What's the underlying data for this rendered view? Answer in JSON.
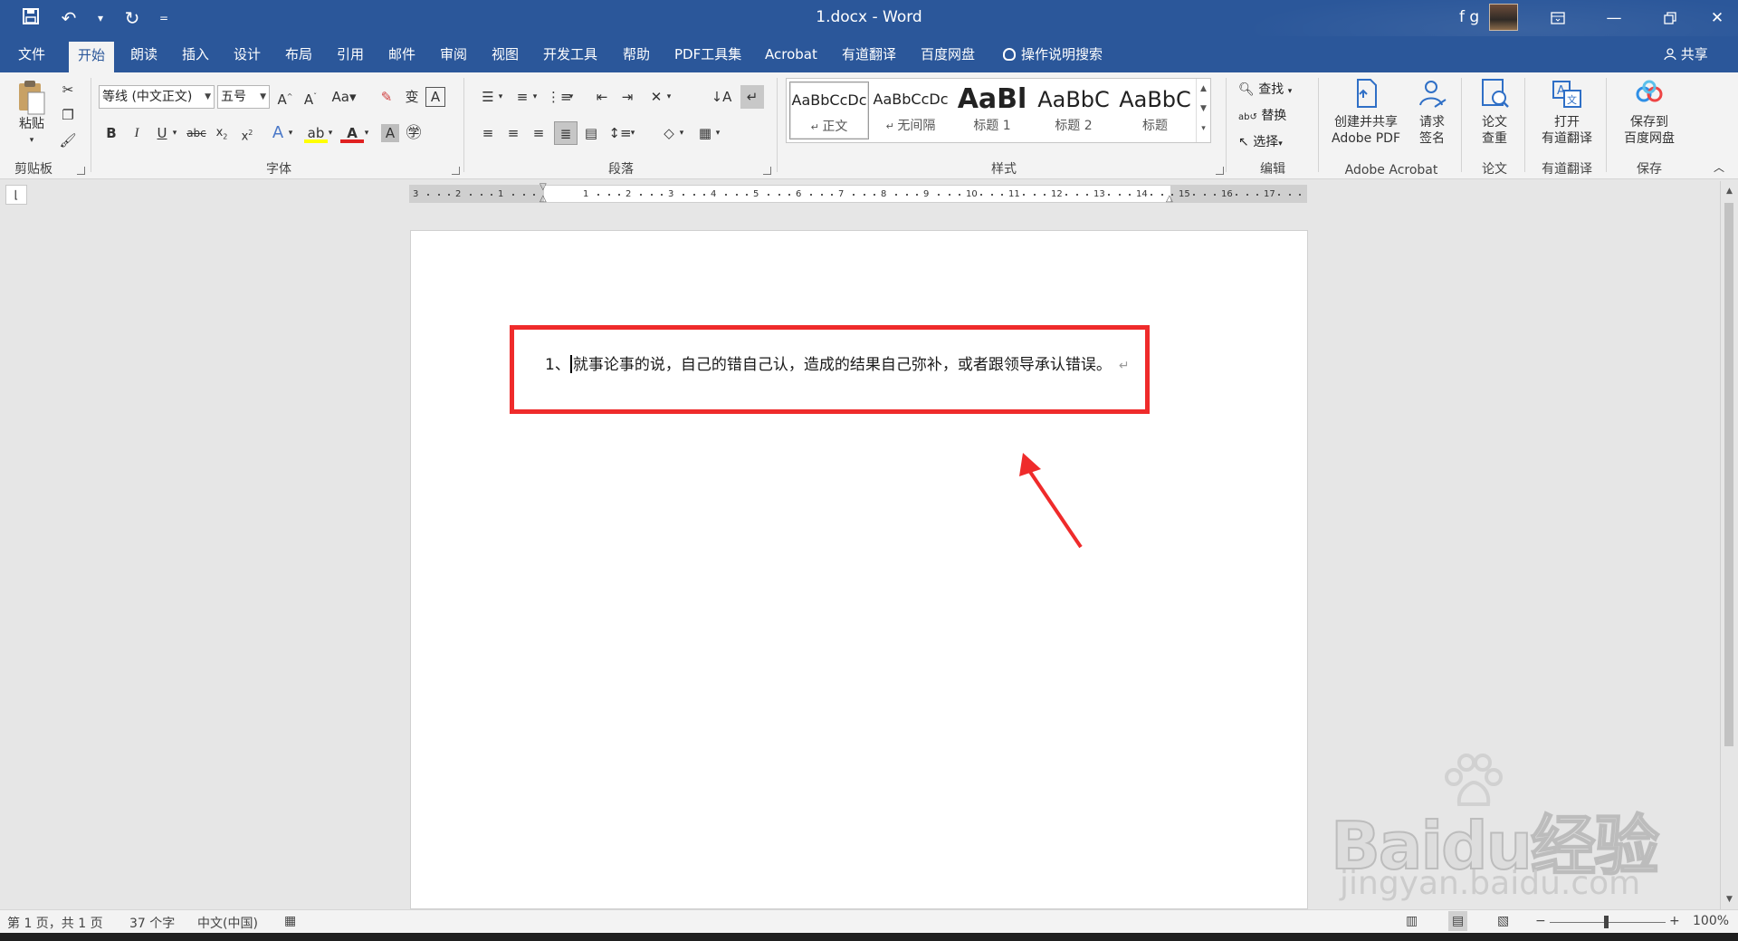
{
  "titlebar": {
    "doc_title": "1.docx  -  Word",
    "user": "f g",
    "qat": {
      "customize_symbol": "="
    }
  },
  "tabs": [
    "文件",
    "开始",
    "朗读",
    "插入",
    "设计",
    "布局",
    "引用",
    "邮件",
    "审阅",
    "视图",
    "开发工具",
    "帮助",
    "PDF工具集",
    "Acrobat",
    "有道翻译",
    "百度网盘",
    "操作说明搜索"
  ],
  "active_tab": "开始",
  "share_label": "共享",
  "ribbon": {
    "clipboard": {
      "paste_label": "粘贴",
      "group_label": "剪贴板"
    },
    "font": {
      "font_name": "等线 (中文正文)",
      "font_size": "五号",
      "group_label": "字体",
      "change_case": "Aa"
    },
    "paragraph": {
      "group_label": "段落"
    },
    "styles": {
      "group_label": "样式",
      "items": [
        {
          "preview": "AaBbCcDc",
          "name": "正文"
        },
        {
          "preview": "AaBbCcDc",
          "name": "无间隔"
        },
        {
          "preview": "AaBl",
          "name": "标题 1"
        },
        {
          "preview": "AaBbC",
          "name": "标题 2"
        },
        {
          "preview": "AaBbC",
          "name": "标题"
        }
      ]
    },
    "editing": {
      "find": "查找",
      "replace": "替换",
      "select": "选择",
      "group_label": "编辑"
    },
    "acrobat": {
      "create_line1": "创建并共享",
      "create_line2": "Adobe PDF",
      "sign_line1": "请求",
      "sign_line2": "签名",
      "group_label": "Adobe Acrobat"
    },
    "thesis": {
      "line1": "论文",
      "line2": "查重",
      "group_label": "论文"
    },
    "youdao": {
      "line1": "打开",
      "line2": "有道翻译",
      "group_label": "有道翻译"
    },
    "baidu": {
      "line1": "保存到",
      "line2": "百度网盘",
      "group_label": "保存"
    }
  },
  "ruler": {
    "ticks": [
      "3",
      "2",
      "1",
      "1",
      "2",
      "3",
      "4",
      "5",
      "6",
      "7",
      "8",
      "9",
      "10",
      "11",
      "12",
      "13",
      "14",
      "15",
      "16",
      "17"
    ]
  },
  "document": {
    "paragraph_number": "1、",
    "paragraph_text": "就事论事的说，自己的错自己认，造成的结果自己弥补，或者跟领导承认错误。",
    "paragraph_mark": "↵"
  },
  "annotation_color": "#ef2b2b",
  "status": {
    "page": "第 1 页，共 1 页",
    "words": "37 个字",
    "language": "中文(中国)",
    "zoom": "100%",
    "zoom_minus": "−",
    "zoom_plus": "+"
  },
  "watermark": {
    "brand": "Baidu经验",
    "url": "jingyan.baidu.com"
  }
}
